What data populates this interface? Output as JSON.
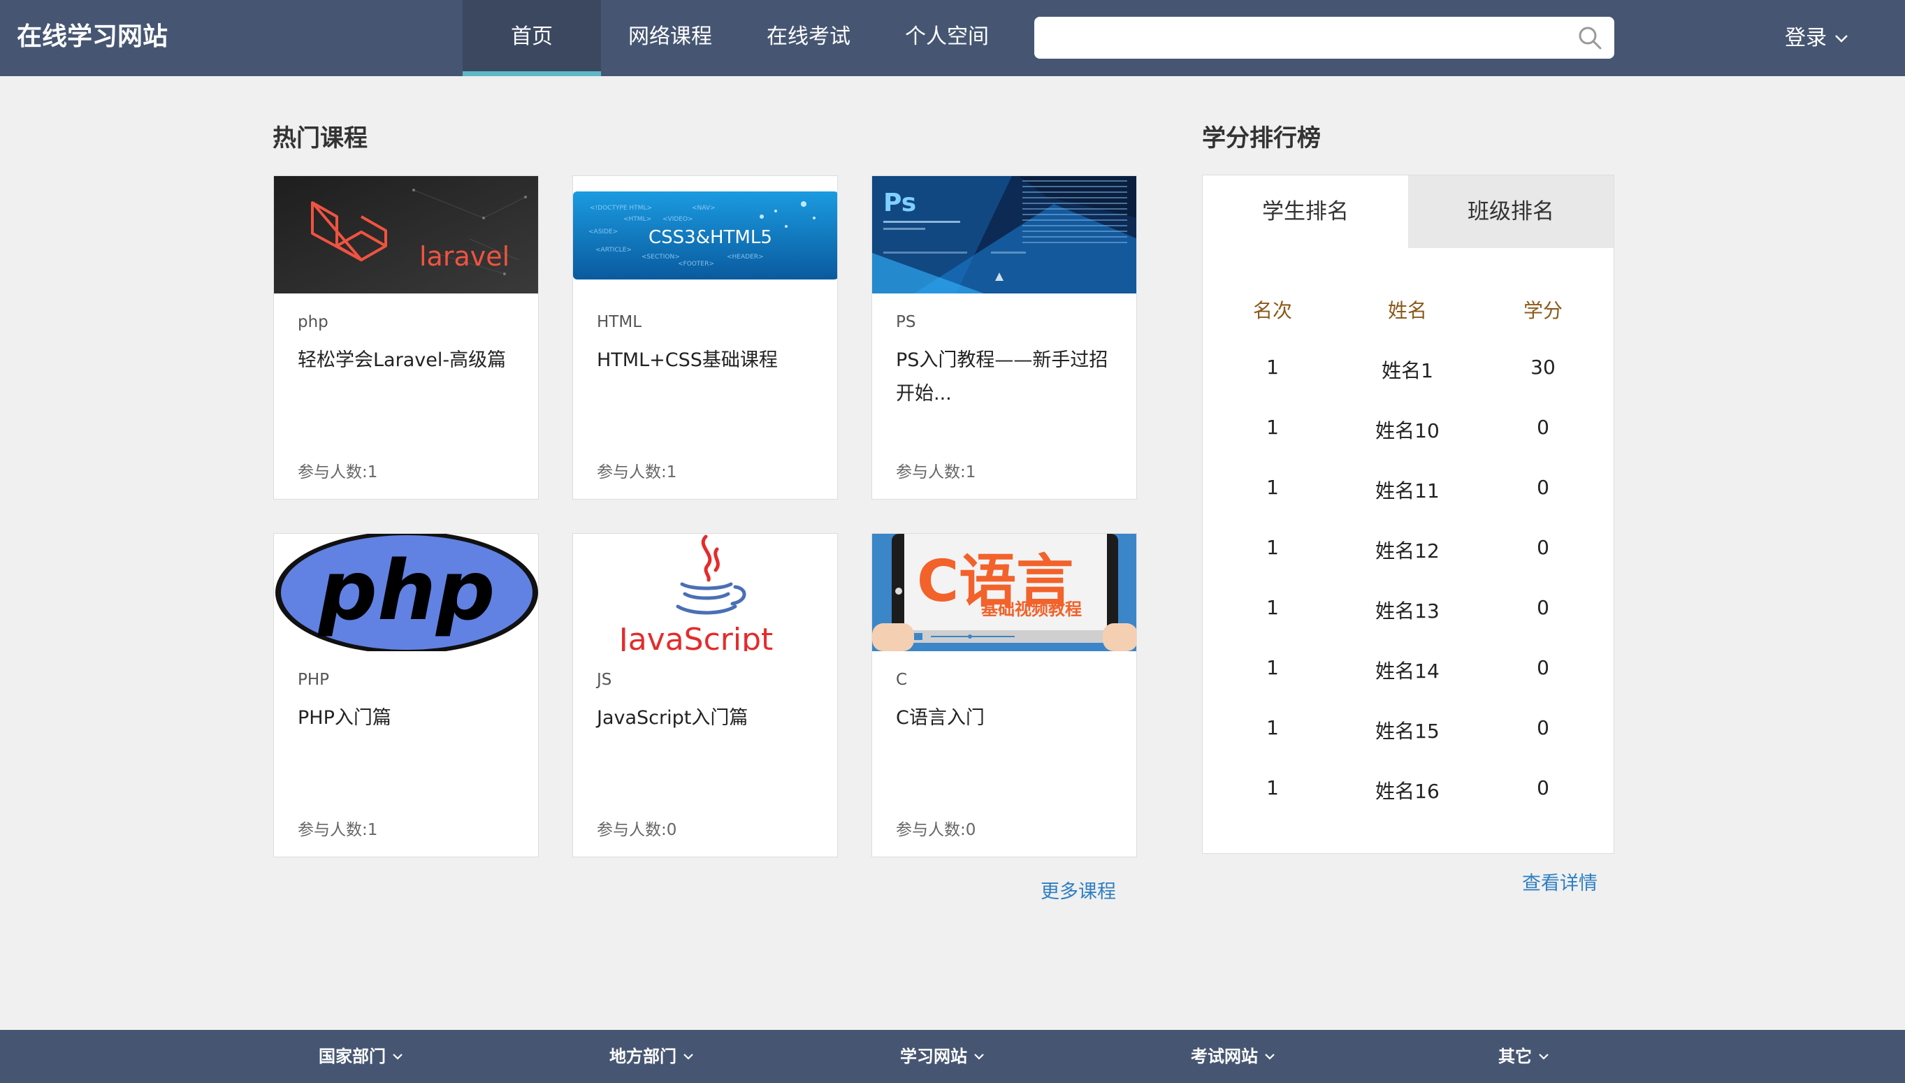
{
  "header": {
    "brand": "在线学习网站",
    "nav": [
      "首页",
      "网络课程",
      "在线考试",
      "个人空间"
    ],
    "active_nav": "首页",
    "search": {
      "value": "",
      "placeholder": ""
    },
    "login_label": "登录"
  },
  "courses": {
    "title": "热门课程",
    "more_label": "更多课程",
    "items": [
      {
        "image": "laravel-logo",
        "image_text": "laravel",
        "category": "php",
        "title": "轻松学会Laravel-高级篇",
        "count": "参与人数:1"
      },
      {
        "image": "css3-html5-banner",
        "image_text": "CSS3&HTML5",
        "category": "HTML",
        "title": "HTML+CSS基础课程",
        "count": "参与人数:1"
      },
      {
        "image": "photoshop-splash",
        "image_text": "Ps",
        "category": "PS",
        "title": "PS入门教程——新手过招 开始...",
        "count": "参与人数:1"
      },
      {
        "image": "php-logo",
        "image_text": "php",
        "category": "PHP",
        "title": "PHP入门篇",
        "count": "参与人数:1"
      },
      {
        "image": "javascript-logo",
        "image_text": "JavaScript",
        "category": "JS",
        "title": "JavaScript入门篇",
        "count": "参与人数:0"
      },
      {
        "image": "c-language-banner",
        "image_text": "C语言",
        "image_subtext": "基础视频教程",
        "category": "C",
        "title": "C语言入门",
        "count": "参与人数:0"
      }
    ]
  },
  "ranking": {
    "title": "学分排行榜",
    "tabs": [
      "学生排名",
      "班级排名"
    ],
    "active_tab": "学生排名",
    "columns": [
      "名次",
      "姓名",
      "学分"
    ],
    "rows": [
      [
        "1",
        "姓名1",
        "30"
      ],
      [
        "1",
        "姓名10",
        "0"
      ],
      [
        "1",
        "姓名11",
        "0"
      ],
      [
        "1",
        "姓名12",
        "0"
      ],
      [
        "1",
        "姓名13",
        "0"
      ],
      [
        "1",
        "姓名14",
        "0"
      ],
      [
        "1",
        "姓名15",
        "0"
      ],
      [
        "1",
        "姓名16",
        "0"
      ]
    ],
    "details_label": "查看详情"
  },
  "footer": {
    "items": [
      "国家部门",
      "地方部门",
      "学习网站",
      "考试网站",
      "其它"
    ]
  },
  "colors": {
    "header_bg": "#465672",
    "active_indicator": "#5fb7c7",
    "link": "#2f7fc1",
    "rank_header": "#8b5a1a",
    "page_bg": "#f0f0f0"
  }
}
